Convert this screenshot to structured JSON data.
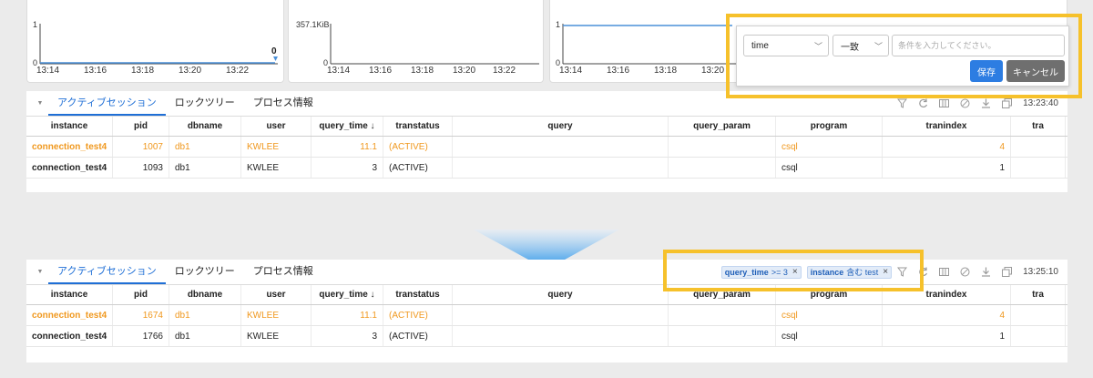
{
  "colors": {
    "accent": "#1f6fd6",
    "highlight": "#f6c12b",
    "active_row": "#f0981e",
    "save": "#2d7de2",
    "cancel": "#6f6f6f"
  },
  "charts": [
    {
      "y_top": "1",
      "y_bottom": "0",
      "x_ticks": [
        "13:14",
        "13:16",
        "13:18",
        "13:20",
        "13:22"
      ],
      "value": "0"
    },
    {
      "y_top": "357.1KiB",
      "y_bottom": "0",
      "x_ticks": [
        "13:14",
        "13:16",
        "13:18",
        "13:20",
        "13:22"
      ]
    },
    {
      "y_top": "1",
      "y_bottom": "0",
      "x_ticks": [
        "13:14",
        "13:16",
        "13:18",
        "13:20"
      ]
    }
  ],
  "tabs": [
    "アクティブセッション",
    "ロックツリー",
    "プロセス情報"
  ],
  "columns": [
    "instance",
    "pid",
    "dbname",
    "user",
    "query_time ↓",
    "transtatus",
    "query",
    "query_param",
    "program",
    "tranindex",
    "tra"
  ],
  "before": {
    "time": "13:23:40",
    "rows": [
      {
        "instance": "connection_test4",
        "pid": "1007",
        "dbname": "db1",
        "user": "KWLEE",
        "query_time": "11.1",
        "transtatus": "(ACTIVE)",
        "query": "",
        "query_param": "",
        "program": "csql",
        "tranindex": "4"
      },
      {
        "instance": "connection_test4",
        "pid": "1093",
        "dbname": "db1",
        "user": "KWLEE",
        "query_time": "3",
        "transtatus": "(ACTIVE)",
        "query": "",
        "query_param": "",
        "program": "csql",
        "tranindex": "1"
      }
    ]
  },
  "filter_popup": {
    "field": "time",
    "operator": "一致",
    "placeholder": "条件を入力してください。",
    "value": "",
    "save_label": "保存",
    "cancel_label": "キャンセル"
  },
  "after": {
    "time": "13:25:10",
    "chips": [
      {
        "key": "query_time",
        "op": ">= 3"
      },
      {
        "key": "instance",
        "op": "含む test"
      }
    ],
    "rows": [
      {
        "instance": "connection_test4",
        "pid": "1674",
        "dbname": "db1",
        "user": "KWLEE",
        "query_time": "11.1",
        "transtatus": "(ACTIVE)",
        "query": "",
        "query_param": "",
        "program": "csql",
        "tranindex": "4"
      },
      {
        "instance": "connection_test4",
        "pid": "1766",
        "dbname": "db1",
        "user": "KWLEE",
        "query_time": "3",
        "transtatus": "(ACTIVE)",
        "query": "",
        "query_param": "",
        "program": "csql",
        "tranindex": "1"
      }
    ]
  },
  "icons": [
    "filter-icon",
    "refresh-icon",
    "columns-icon",
    "block-icon",
    "download-icon",
    "copy-icon",
    "collapse-arrow-icon",
    "chevron-down-icon",
    "close-icon"
  ]
}
